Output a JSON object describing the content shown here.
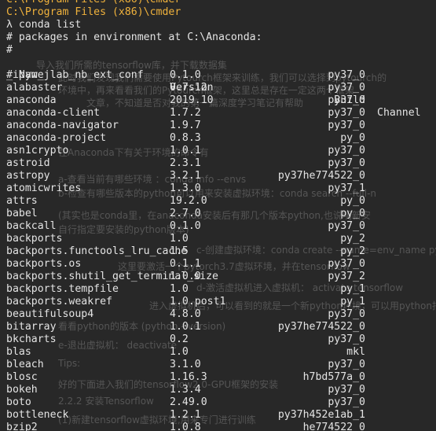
{
  "terminal": {
    "prompt_path": "C:\\Program Files (x86)\\cmder",
    "command": "λ conda list",
    "env_line": "# packages in environment at C:\\Anaconda:",
    "hash_line": "#",
    "header": {
      "name": "# Name",
      "version": "Version",
      "build": "Build",
      "channel": "Channel"
    },
    "packages": [
      {
        "name": "_ipyw_jlab_nb_ext_conf",
        "version": "0.1.0",
        "build": "py37_0"
      },
      {
        "name": "alabaster",
        "version": "0.7.12",
        "build": "py37_0"
      },
      {
        "name": "anaconda",
        "version": "2019.10",
        "build": "py37_0"
      },
      {
        "name": "anaconda-client",
        "version": "1.7.2",
        "build": "py37_0"
      },
      {
        "name": "anaconda-navigator",
        "version": "1.9.7",
        "build": "py37_0"
      },
      {
        "name": "anaconda-project",
        "version": "0.8.3",
        "build": "py_0"
      },
      {
        "name": "asn1crypto",
        "version": "1.0.1",
        "build": "py37_0"
      },
      {
        "name": "astroid",
        "version": "2.3.1",
        "build": "py37_0"
      },
      {
        "name": "astropy",
        "version": "3.2.1",
        "build": "py37he774522_0"
      },
      {
        "name": "atomicwrites",
        "version": "1.3.0",
        "build": "py37_1"
      },
      {
        "name": "attrs",
        "version": "19.2.0",
        "build": "py_0"
      },
      {
        "name": "babel",
        "version": "2.7.0",
        "build": "py_0"
      },
      {
        "name": "backcall",
        "version": "0.1.0",
        "build": "py37_0"
      },
      {
        "name": "backports",
        "version": "1.0",
        "build": "py_2"
      },
      {
        "name": "backports.functools_lru_cache",
        "version": "1.5",
        "build": "py_2"
      },
      {
        "name": "backports.os",
        "version": "0.1.1",
        "build": "py37_0"
      },
      {
        "name": "backports.shutil_get_terminal_size",
        "version": "1.0.0",
        "build": "py37_2"
      },
      {
        "name": "backports.tempfile",
        "version": "1.0",
        "build": "py_1"
      },
      {
        "name": "backports.weakref",
        "version": "1.0.post1",
        "build": "py_1"
      },
      {
        "name": "beautifulsoup4",
        "version": "4.8.0",
        "build": "py37_0"
      },
      {
        "name": "bitarray",
        "version": "1.0.1",
        "build": "py37he774522_0"
      },
      {
        "name": "bkcharts",
        "version": "0.2",
        "build": "py37_0"
      },
      {
        "name": "blas",
        "version": "1.0",
        "build": "mkl"
      },
      {
        "name": "bleach",
        "version": "3.1.0",
        "build": "py37_0"
      },
      {
        "name": "blosc",
        "version": "1.16.3",
        "build": "h7bd577a_0"
      },
      {
        "name": "bokeh",
        "version": "1.3.4",
        "build": "py37_0"
      },
      {
        "name": "boto",
        "version": "2.49.0",
        "build": "py37_0"
      },
      {
        "name": "bottleneck",
        "version": "1.2.1",
        "build": "py37h452e1ab_1"
      },
      {
        "name": "bzip2",
        "version": "1.0.8",
        "build": "he774522_0"
      }
    ]
  },
  "background_doc": {
    "lines": [
      "导入我们所需的tensorflow库，并下载数据集",
      "此时我们发现我们需要使用Pytourch框架来训练，我们可以选择到pytourch的",
      "环境中，再来看看我们的Pytourch框架，这里总是存在一定这两个框架",
      "文章，不知道是否对我的第一篇深度学习笔记有帮助",
      "在Anaconda下有关于环境的命令有",
      "a-查看当前有哪些环境 ：conda info --envs",
      "b-检查有哪些版本的python可以用来安装虚拟环境：conda search --full-n",
      "(其实也是conda里，在anaconda安装后有那几个版本python,也说明新安",
      "自行指定要安装的python版本)",
      "c-创建虚拟环境：conda create --name=env_name python=",
      "这里要激活一个pytorch3.7虚拟环境，并在tensorflow",
      "d-激活虚拟机进入虚拟机： activate tensorflow",
      "进入虚拟机后，可以看到的就是一个新python环境，可以用python指令操",
      "看看python的版本 (python --version)",
      "e-退出虚拟机： deactivate",
      "Tips:",
      "好的下面进入我们的tensorflow2.0-GPU框架的安装",
      "2.2.2 安装Tensorflow",
      "(1)新建tensorflow虚拟环境,用来专门进行训练"
    ]
  }
}
